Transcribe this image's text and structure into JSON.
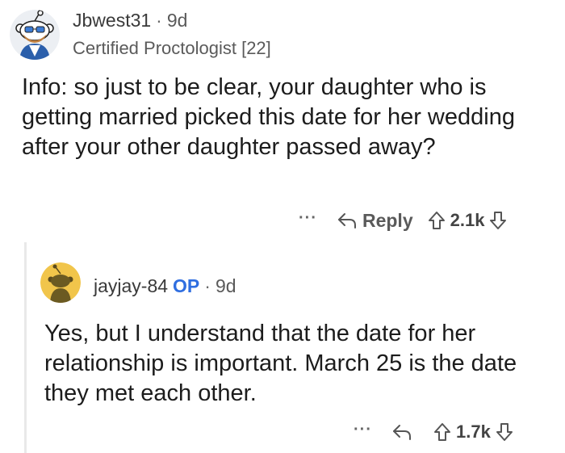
{
  "comments": [
    {
      "username": "Jbwest31",
      "separator": "·",
      "age": "9d",
      "flair": "Certified Proctologist [22]",
      "body": "Info: so just to be clear, your daughter who is getting married picked this date for her wedding after your other daughter passed away?",
      "actions": {
        "more": "···",
        "reply_label": "Reply",
        "upvotes": "2.1k"
      },
      "avatar": {
        "icon": "snoo-avatar-icon",
        "color": "#e6e6e6"
      }
    },
    {
      "username": "jayjay-84",
      "op_badge": "OP",
      "separator": "·",
      "age": "9d",
      "body": "Yes, but I understand that the date for her relationship is important. March 25 is the date they met each other.",
      "actions": {
        "more": "···",
        "upvotes": "1.7k"
      },
      "avatar": {
        "icon": "snoo-avatar-icon",
        "color": "#f1c54b"
      }
    }
  ],
  "colors": {
    "op_badge": "#2f6ee0",
    "thread_line": "#e9e9e9",
    "text": "#1c1c1c",
    "muted": "#5a5a5a"
  }
}
